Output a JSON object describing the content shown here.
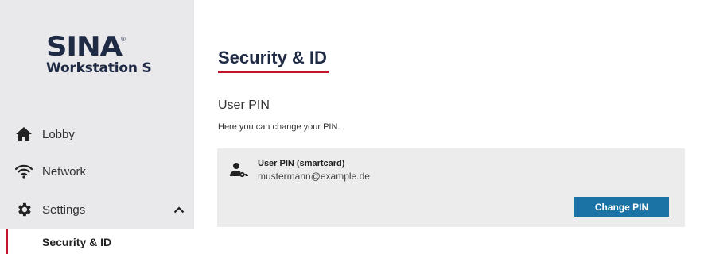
{
  "brand": {
    "logo_text": "SINA",
    "registered": "®",
    "product": "Workstation S"
  },
  "sidebar": {
    "items": [
      {
        "label": "Lobby",
        "icon": "home-icon"
      },
      {
        "label": "Network",
        "icon": "wifi-icon"
      },
      {
        "label": "Settings",
        "icon": "gear-icon",
        "expanded": true
      }
    ],
    "subitems": [
      {
        "label": "Security & ID",
        "selected": true
      }
    ]
  },
  "main": {
    "title": "Security & ID",
    "section": {
      "title": "User PIN",
      "description": "Here you can change your PIN."
    },
    "card": {
      "title": "User PIN (smartcard)",
      "email": "mustermann@example.de",
      "icon": "user-key-icon",
      "button_label": "Change PIN"
    }
  },
  "colors": {
    "accent": "#c4122f",
    "button": "#1a72a5",
    "sidebar_bg": "#e9e9eb",
    "brand_text": "#1f2a44"
  }
}
